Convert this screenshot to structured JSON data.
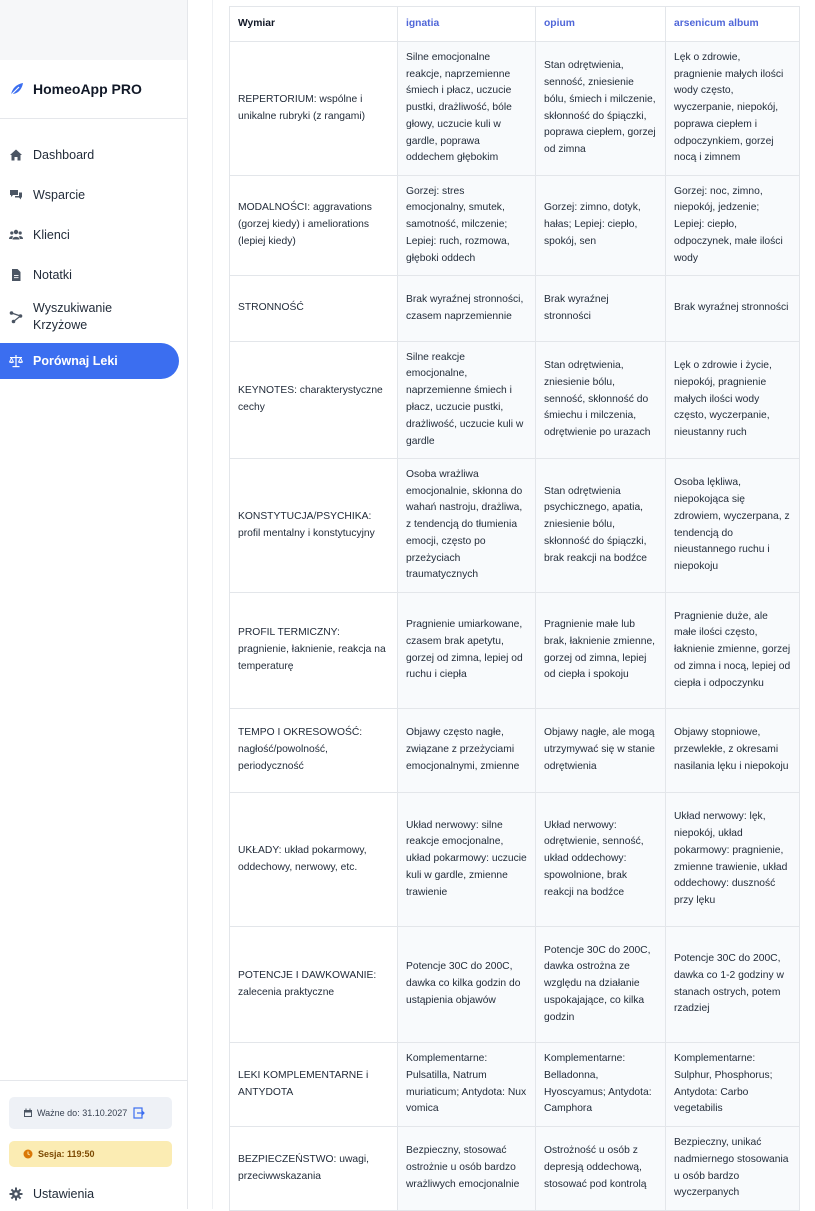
{
  "app": {
    "name": "HomeoApp PRO"
  },
  "sidebar": {
    "items": [
      {
        "label": "Dashboard",
        "icon": "home-icon"
      },
      {
        "label": "Wsparcie",
        "icon": "chat-icon"
      },
      {
        "label": "Klienci",
        "icon": "users-icon"
      },
      {
        "label": "Notatki",
        "icon": "document-icon"
      },
      {
        "label": "Wyszukiwanie Krzyżowe",
        "icon": "network-icon"
      },
      {
        "label": "Porównaj Leki",
        "icon": "scale-icon",
        "active": true
      }
    ],
    "valid_until": "Ważne do: 31.10.2027",
    "session": "Sesja: 119:50",
    "settings": "Ustawienia"
  },
  "table": {
    "headers": [
      "Wymiar",
      "ignatia",
      "opium",
      "arsenicum album"
    ],
    "rows": [
      {
        "dimension": "REPERTORIUM: wspólne i unikalne rubryki (z rangami)",
        "ignatia": "Silne emocjonalne reakcje, naprzemienne śmiech i płacz, uczucie pustki, drażliwość, bóle głowy, uczucie kuli w gardle, poprawa oddechem głębokim",
        "opium": "Stan odrętwienia, senność, zniesienie bólu, śmiech i milczenie, skłonność do śpiączki, poprawa ciepłem, gorzej od zimna",
        "arsenicum": "Lęk o zdrowie, pragnienie małych ilości wody często, wyczerpanie, niepokój, poprawa ciepłem i odpoczynkiem, gorzej nocą i zimnem"
      },
      {
        "dimension": "MODALNOŚCI: aggravations (gorzej kiedy) i ameliorations (lepiej kiedy)",
        "ignatia": "Gorzej: stres emocjonalny, smutek, samotność, milczenie; Lepiej: ruch, rozmowa, głęboki oddech",
        "opium": "Gorzej: zimno, dotyk, hałas; Lepiej: ciepło, spokój, sen",
        "arsenicum": "Gorzej: noc, zimno, niepokój, jedzenie; Lepiej: ciepło, odpoczynek, małe ilości wody"
      },
      {
        "dimension": "STRONNOŚĆ",
        "ignatia": "Brak wyraźnej stronności, czasem naprzemiennie",
        "opium": "Brak wyraźnej stronności",
        "arsenicum": "Brak wyraźnej stronności"
      },
      {
        "dimension": "KEYNOTES: charakterystyczne cechy",
        "ignatia": "Silne reakcje emocjonalne, naprzemienne śmiech i płacz, uczucie pustki, drażliwość, uczucie kuli w gardle",
        "opium": "Stan odrętwienia, zniesienie bólu, senność, skłonność do śmiechu i milczenia, odrętwienie po urazach",
        "arsenicum": "Lęk o zdrowie i życie, niepokój, pragnienie małych ilości wody często, wyczerpanie, nieustanny ruch"
      },
      {
        "dimension": "KONSTYTUCJA/PSYCHIKA: profil mentalny i konstytucyjny",
        "ignatia": "Osoba wrażliwa emocjonalnie, skłonna do wahań nastroju, drażliwa, z tendencją do tłumienia emocji, często po przeżyciach traumatycznych",
        "opium": "Stan odrętwienia psychicznego, apatia, zniesienie bólu, skłonność do śpiączki, brak reakcji na bodźce",
        "arsenicum": "Osoba lękliwa, niepokojąca się zdrowiem, wyczerpana, z tendencją do nieustannego ruchu i niepokoju"
      },
      {
        "dimension": "PROFIL TERMICZNY: pragnienie, łaknienie, reakcja na temperaturę",
        "ignatia": "Pragnienie umiarkowane, czasem brak apetytu, gorzej od zimna, lepiej od ruchu i ciepła",
        "opium": "Pragnienie małe lub brak, łaknienie zmienne, gorzej od zimna, lepiej od ciepła i spokoju",
        "arsenicum": "Pragnienie duże, ale małe ilości często, łaknienie zmienne, gorzej od zimna i nocą, lepiej od ciepła i odpoczynku"
      },
      {
        "dimension": "TEMPO I OKRESOWOŚĆ: nagłość/powolność, periodyczność",
        "ignatia": "Objawy często nagłe, związane z przeżyciami emocjonalnymi, zmienne",
        "opium": "Objawy nagłe, ale mogą utrzymywać się w stanie odrętwienia",
        "arsenicum": "Objawy stopniowe, przewlekłe, z okresami nasilania lęku i niepokoju"
      },
      {
        "dimension": "UKŁADY: układ pokarmowy, oddechowy, nerwowy, etc.",
        "ignatia": "Układ nerwowy: silne reakcje emocjonalne, układ pokarmowy: uczucie kuli w gardle, zmienne trawienie",
        "opium": "Układ nerwowy: odrętwienie, senność, układ oddechowy: spowolnione, brak reakcji na bodźce",
        "arsenicum": "Układ nerwowy: lęk, niepokój, układ pokarmowy: pragnienie, zmienne trawienie, układ oddechowy: duszność przy lęku"
      },
      {
        "dimension": "POTENCJE I DAWKOWANIE: zalecenia praktyczne",
        "ignatia": "Potencje 30C do 200C, dawka co kilka godzin do ustąpienia objawów",
        "opium": "Potencje 30C do 200C, dawka ostrożna ze względu na działanie uspokajające, co kilka godzin",
        "arsenicum": "Potencje 30C do 200C, dawka co 1-2 godziny w stanach ostrych, potem rzadziej"
      },
      {
        "dimension": "LEKI KOMPLEMENTARNE i ANTYDOTA",
        "ignatia": "Komplementarne: Pulsatilla, Natrum muriaticum; Antydota: Nux vomica",
        "opium": "Komplementarne: Belladonna, Hyoscyamus; Antydota: Camphora",
        "arsenicum": "Komplementarne: Sulphur, Phosphorus; Antydota: Carbo vegetabilis"
      },
      {
        "dimension": "BEZPIECZEŃSTWO: uwagi, przeciwwskazania",
        "ignatia": "Bezpieczny, stosować ostrożnie u osób bardzo wrażliwych emocjonalnie",
        "opium": "Ostrożność u osób z depresją oddechową, stosować pod kontrolą",
        "arsenicum": "Bezpieczny, unikać nadmiernego stosowania u osób bardzo wyczerpanych"
      }
    ]
  }
}
